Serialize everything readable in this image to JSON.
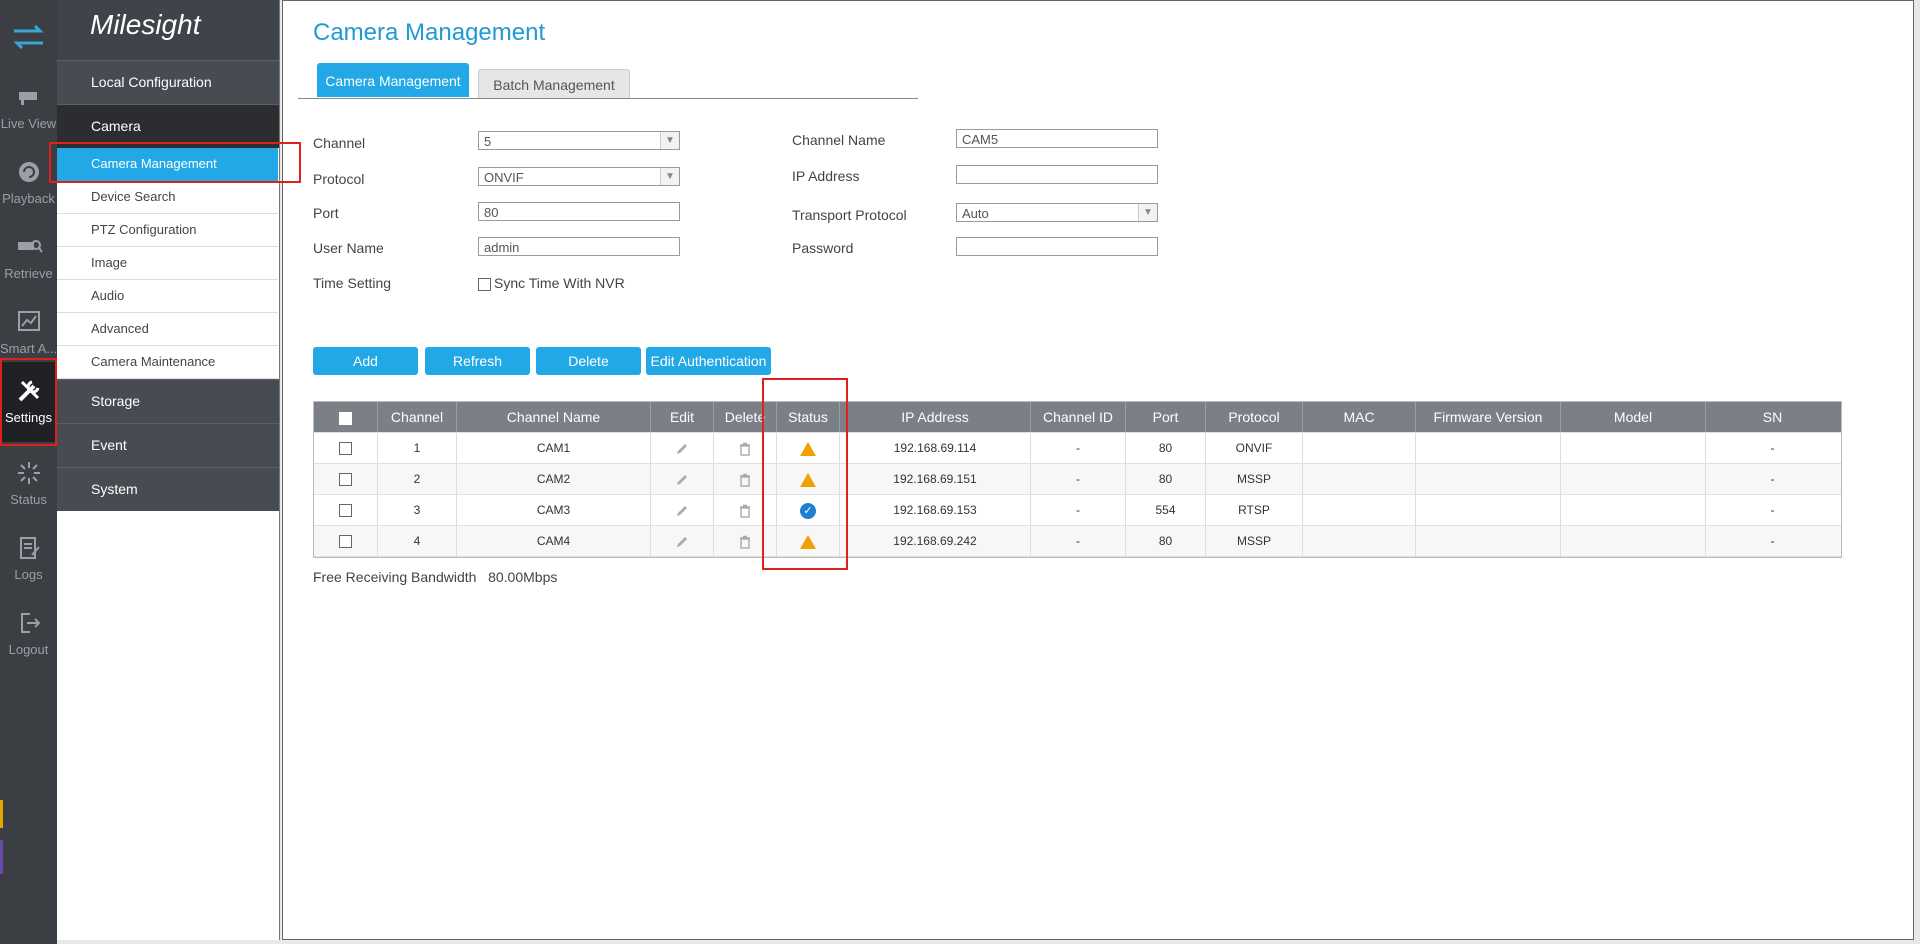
{
  "rail": {
    "items": [
      {
        "label": "Live View",
        "icon": "live-view-icon"
      },
      {
        "label": "Playback",
        "icon": "playback-icon"
      },
      {
        "label": "Retrieve",
        "icon": "retrieve-icon"
      },
      {
        "label": "Smart A...",
        "icon": "smart-analytics-icon"
      },
      {
        "label": "Settings",
        "icon": "settings-icon",
        "active": true
      },
      {
        "label": "Status",
        "icon": "status-icon"
      },
      {
        "label": "Logs",
        "icon": "logs-icon"
      },
      {
        "label": "Logout",
        "icon": "logout-icon"
      }
    ]
  },
  "nav": {
    "logo": "Milesight",
    "sections": {
      "local": "Local Configuration",
      "camera": "Camera",
      "storage": "Storage",
      "event": "Event",
      "system": "System"
    },
    "camera_items": [
      "Camera Management",
      "Device Search",
      "PTZ Configuration",
      "Image",
      "Audio",
      "Advanced",
      "Camera Maintenance"
    ]
  },
  "main": {
    "title": "Camera Management",
    "tabs": [
      "Camera Management",
      "Batch Management"
    ],
    "form": {
      "channel_label": "Channel",
      "channel_value": "5",
      "protocol_label": "Protocol",
      "protocol_value": "ONVIF",
      "port_label": "Port",
      "port_value": "80",
      "username_label": "User Name",
      "username_value": "admin",
      "time_label": "Time Setting",
      "sync_label": "Sync Time With NVR",
      "chname_label": "Channel Name",
      "chname_value": "CAM5",
      "ip_label": "IP Address",
      "ip_value": "",
      "transport_label": "Transport Protocol",
      "transport_value": "Auto",
      "password_label": "Password",
      "password_value": ""
    },
    "buttons": {
      "add": "Add",
      "refresh": "Refresh",
      "delete": "Delete",
      "edit_auth": "Edit Authentication"
    },
    "table": {
      "headers": [
        "",
        "Channel",
        "Channel Name",
        "Edit",
        "Delete",
        "Status",
        "IP Address",
        "Channel ID",
        "Port",
        "Protocol",
        "MAC",
        "Firmware Version",
        "Model",
        "SN"
      ],
      "rows": [
        {
          "channel": "1",
          "name": "CAM1",
          "status": "warning",
          "ip": "192.168.69.114",
          "chid": "-",
          "port": "80",
          "protocol": "ONVIF",
          "mac": "",
          "fw": "",
          "model": "",
          "sn": "-"
        },
        {
          "channel": "2",
          "name": "CAM2",
          "status": "warning",
          "ip": "192.168.69.151",
          "chid": "-",
          "port": "80",
          "protocol": "MSSP",
          "mac": "",
          "fw": "",
          "model": "",
          "sn": "-"
        },
        {
          "channel": "3",
          "name": "CAM3",
          "status": "connected",
          "ip": "192.168.69.153",
          "chid": "-",
          "port": "554",
          "protocol": "RTSP",
          "mac": "",
          "fw": "",
          "model": "",
          "sn": "-"
        },
        {
          "channel": "4",
          "name": "CAM4",
          "status": "warning",
          "ip": "192.168.69.242",
          "chid": "-",
          "port": "80",
          "protocol": "MSSP",
          "mac": "",
          "fw": "",
          "model": "",
          "sn": "-"
        }
      ]
    },
    "bandwidth_label": "Free Receiving Bandwidth",
    "bandwidth_value": "80.00Mbps"
  },
  "colors": {
    "accent": "#22a8e6",
    "highlight": "#e0201e",
    "warning": "#f0a000",
    "ok": "#1f7fd0"
  }
}
